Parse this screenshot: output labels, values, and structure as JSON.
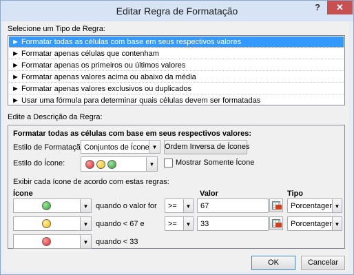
{
  "window": {
    "title": "Editar Regra de Formatação",
    "help_glyph": "?",
    "close_glyph": "✕"
  },
  "rule_type": {
    "heading": "Selecione um Tipo de Regra:",
    "items": [
      "► Formatar todas as células com base em seus respectivos valores",
      "► Formatar apenas células que contenham",
      "► Formatar apenas os primeiros ou últimos valores",
      "► Formatar apenas valores acima ou abaixo da média",
      "► Formatar apenas valores exclusivos ou duplicados",
      "► Usar uma fórmula para determinar quais células devem ser formatadas"
    ],
    "selected_index": 0
  },
  "description": {
    "heading": "Edite a Descrição da Regra:",
    "subheading": "Formatar todas as células com base em seus respectivos valores:",
    "format_style_label": "Estilo de Formatação:",
    "format_style_value": "Conjuntos de Ícones",
    "reverse_button": "Ordem Inversa de Ícones",
    "icon_style_label": "Estilo do Ícone:",
    "show_only_icon_label": "Mostrar Somente Ícone",
    "show_only_icon_checked": false,
    "rules_heading": "Exibir cada ícone de acordo com estas regras:",
    "col_icon": "Ícone",
    "col_value": "Valor",
    "col_type": "Tipo",
    "icon_rows": [
      {
        "icon": "green-circle-icon",
        "condition": "quando o valor for",
        "operator": ">=",
        "value": "67",
        "type": "Porcentagem"
      },
      {
        "icon": "yellow-circle-icon",
        "condition": "quando < 67 e",
        "operator": ">=",
        "value": "33",
        "type": "Porcentagem"
      },
      {
        "icon": "red-circle-icon",
        "condition": "quando < 33"
      }
    ]
  },
  "footer": {
    "ok": "OK",
    "cancel": "Cancelar"
  },
  "colors": {
    "selection": "#3399ff",
    "close": "#c75050",
    "titlebar": "#d6e4f5"
  }
}
